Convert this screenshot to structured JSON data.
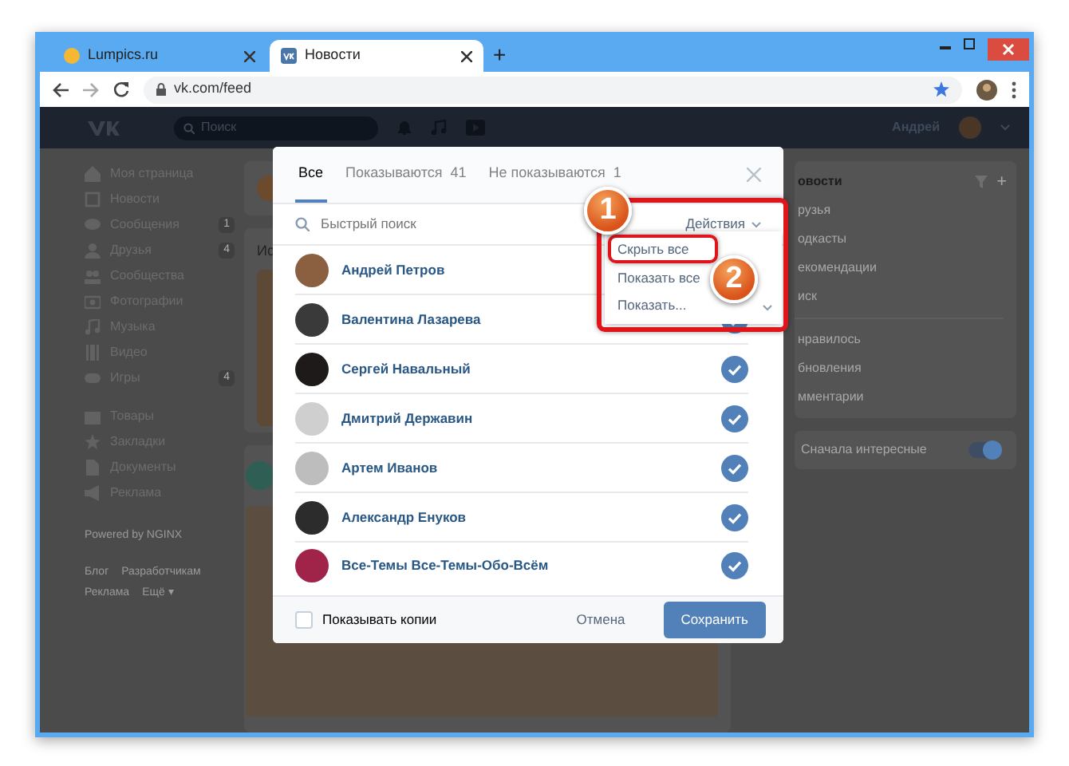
{
  "browser": {
    "tabs": [
      {
        "title": "Lumpics.ru",
        "selected": false
      },
      {
        "title": "Новости",
        "selected": true
      }
    ],
    "new_tab": "+",
    "address": "vk.com/feed"
  },
  "header": {
    "search_placeholder": "Поиск",
    "user_name": "Андрей"
  },
  "left_menu": [
    {
      "label": "Моя страница"
    },
    {
      "label": "Новости"
    },
    {
      "label": "Сообщения",
      "count": "1"
    },
    {
      "label": "Друзья",
      "count": "4"
    },
    {
      "label": "Сообщества"
    },
    {
      "label": "Фотографии"
    },
    {
      "label": "Музыка"
    },
    {
      "label": "Видео"
    },
    {
      "label": "Игры",
      "count": "4"
    }
  ],
  "left_menu_2": [
    {
      "label": "Товары"
    },
    {
      "label": "Закладки"
    },
    {
      "label": "Документы"
    },
    {
      "label": "Реклама"
    }
  ],
  "powered_by": "Powered by NGINX",
  "footer_links": [
    "Блог",
    "Разработчикам",
    "Реклама",
    "Ещё ▾"
  ],
  "feed": {
    "story_label": "Ис"
  },
  "right_menu": {
    "title": "овости",
    "add": "+",
    "items": [
      "рузья",
      "одкасты",
      "екомендации",
      "иск"
    ],
    "items_2": [
      "нравилось",
      "бновления",
      "мментарии"
    ],
    "toggle": {
      "label": "Сначала интересные",
      "on": true
    }
  },
  "modal": {
    "tabs": [
      {
        "label": "Все",
        "selected": true
      },
      {
        "label": "Показываются",
        "count": "41",
        "selected": false
      },
      {
        "label": "Не показываются",
        "count": "1",
        "selected": false
      }
    ],
    "search_placeholder": "Быстрый поиск",
    "actions": "Действия",
    "dropdown": [
      "Скрыть все",
      "Показать все",
      "Показать..."
    ],
    "people": [
      {
        "name": "Андрей Петров"
      },
      {
        "name": "Валентина Лазарева",
        "checked": true
      },
      {
        "name": "Сергей Навальный",
        "checked": true
      },
      {
        "name": "Дмитрий Державин",
        "checked": true
      },
      {
        "name": "Артем Иванов",
        "checked": true
      },
      {
        "name": "Александр Енуков",
        "checked": true
      },
      {
        "name": "Все-Темы Все-Темы-Обо-Всём",
        "checked": true
      }
    ],
    "show_copies": {
      "label": "Показывать копии",
      "checked": false
    },
    "cancel": "Отмена",
    "save": "Сохранить"
  },
  "annotations": [
    "1",
    "2"
  ]
}
